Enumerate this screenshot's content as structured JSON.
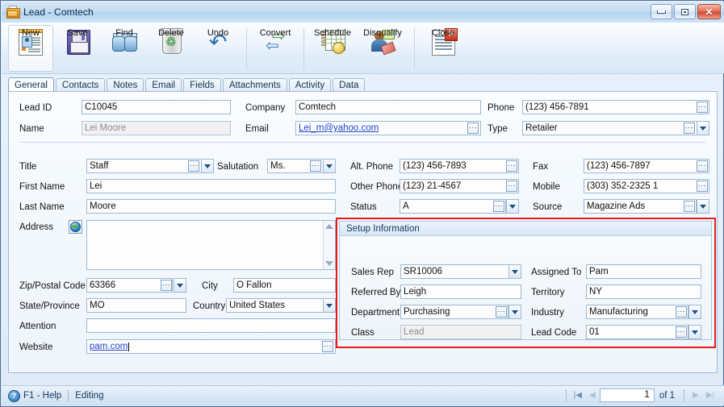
{
  "window": {
    "title": "Lead - Comtech",
    "icon": "lead-folder-icon",
    "buttons": {
      "minimize": "minimize-button",
      "maximize": "maximize-button",
      "close": "close-button"
    }
  },
  "toolbar": {
    "items": [
      {
        "label": "New",
        "icon": "new-lead-card-icon",
        "selected": true
      },
      {
        "label": "Save",
        "icon": "floppy-disk-icon",
        "selected": false
      },
      {
        "label": "Find",
        "icon": "binoculars-icon",
        "selected": false
      },
      {
        "label": "Delete",
        "icon": "recycle-bin-icon",
        "selected": false
      },
      {
        "label": "Undo",
        "icon": "undo-arrow-icon",
        "selected": false
      },
      {
        "label": "Convert",
        "icon": "convert-arrows-icon",
        "selected": false
      },
      {
        "label": "Schedule",
        "icon": "calendar-clock-icon",
        "selected": false
      },
      {
        "label": "Disqualify",
        "icon": "person-tag-icon",
        "selected": false
      },
      {
        "label": "Close",
        "icon": "document-close-icon",
        "selected": false
      }
    ]
  },
  "tabs": [
    {
      "label": "General",
      "active": true
    },
    {
      "label": "Contacts",
      "active": false
    },
    {
      "label": "Notes",
      "active": false
    },
    {
      "label": "Email",
      "active": false
    },
    {
      "label": "Fields",
      "active": false
    },
    {
      "label": "Attachments",
      "active": false
    },
    {
      "label": "Activity",
      "active": false
    },
    {
      "label": "Data",
      "active": false
    }
  ],
  "form": {
    "lead_id": {
      "label": "Lead ID",
      "value": "C10045"
    },
    "name": {
      "label": "Name",
      "value": "Lei Moore",
      "readonly": true
    },
    "company": {
      "label": "Company",
      "value": "Comtech"
    },
    "email": {
      "label": "Email",
      "value": "Lei_m@yahoo.com"
    },
    "phone": {
      "label": "Phone",
      "value": "(123) 456-7891"
    },
    "type": {
      "label": "Type",
      "value": "Retailer"
    },
    "title": {
      "label": "Title",
      "value": "Staff"
    },
    "salutation": {
      "label": "Salutation",
      "value": "Ms."
    },
    "first_name": {
      "label": "First Name",
      "value": "Lei"
    },
    "last_name": {
      "label": "Last Name",
      "value": "Moore"
    },
    "address": {
      "label": "Address",
      "value": ""
    },
    "zip": {
      "label": "Zip/Postal Code",
      "value": "63366"
    },
    "city": {
      "label": "City",
      "value": "O Fallon"
    },
    "state": {
      "label": "State/Province",
      "value": "MO"
    },
    "country": {
      "label": "Country",
      "value": "United States"
    },
    "attention": {
      "label": "Attention",
      "value": ""
    },
    "website": {
      "label": "Website",
      "value": "pam.com"
    },
    "alt_phone": {
      "label": "Alt. Phone",
      "value": "(123) 456-7893"
    },
    "fax": {
      "label": "Fax",
      "value": "(123) 456-7897"
    },
    "other_phone": {
      "label": "Other Phone",
      "value": "(123) 21-4567"
    },
    "mobile": {
      "label": "Mobile",
      "value": "(303) 352-2325 1"
    },
    "status": {
      "label": "Status",
      "value": "A"
    },
    "source": {
      "label": "Source",
      "value": "Magazine Ads"
    }
  },
  "setup_information": {
    "header": "Setup Information",
    "sales_rep": {
      "label": "Sales Rep",
      "value": "SR10006"
    },
    "assigned_to": {
      "label": "Assigned To",
      "value": "Pam"
    },
    "referred_by": {
      "label": "Referred By",
      "value": "Leigh"
    },
    "territory": {
      "label": "Territory",
      "value": "NY"
    },
    "department": {
      "label": "Department",
      "value": "Purchasing"
    },
    "industry": {
      "label": "Industry",
      "value": "Manufacturing"
    },
    "class": {
      "label": "Class",
      "value": "Lead",
      "readonly": true
    },
    "lead_code": {
      "label": "Lead Code",
      "value": "01"
    }
  },
  "statusbar": {
    "help": "F1 - Help",
    "mode": "Editing",
    "page_current": "1",
    "page_of": "of 1",
    "nav": {
      "first": "▮◀",
      "prev": "◀",
      "next": "▶",
      "last": "▶▮"
    }
  },
  "colors": {
    "highlight_box": "#e81b1b",
    "title_bar": "#c3dcf2",
    "link": "#2244cc",
    "field_border": "#9bb8d2"
  }
}
